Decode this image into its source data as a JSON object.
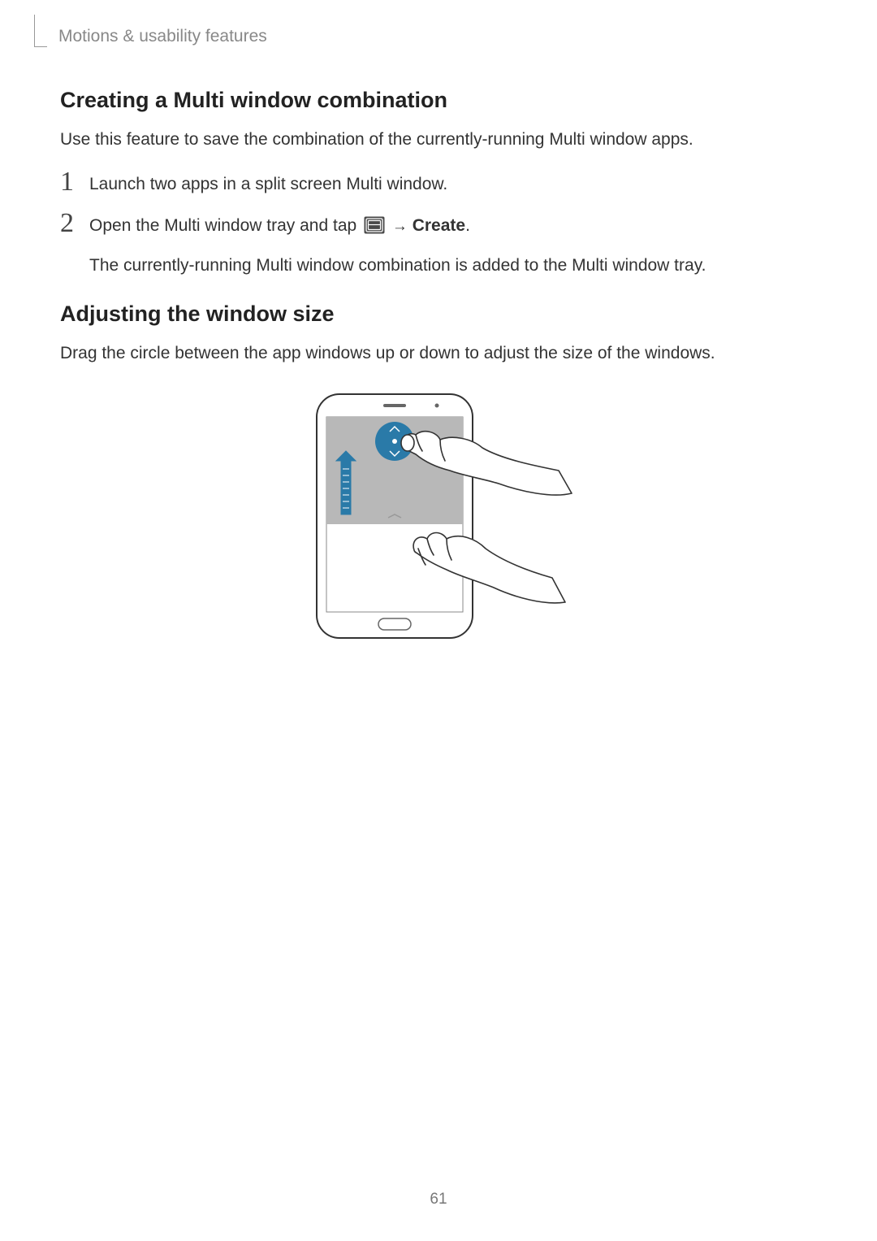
{
  "breadcrumb": "Motions & usability features",
  "section1": {
    "heading": "Creating a Multi window combination",
    "intro": "Use this feature to save the combination of the currently-running Multi window apps.",
    "steps": [
      {
        "num": "1",
        "text": "Launch two apps in a split screen Multi window."
      },
      {
        "num": "2",
        "text_prefix": "Open the Multi window tray and tap ",
        "arrow": "→",
        "create_label": "Create",
        "period": ".",
        "continuation": "The currently-running Multi window combination is added to the Multi window tray."
      }
    ]
  },
  "section2": {
    "heading": "Adjusting the window size",
    "body": "Drag the circle between the app windows up or down to adjust the size of the windows."
  },
  "page_number": "61"
}
